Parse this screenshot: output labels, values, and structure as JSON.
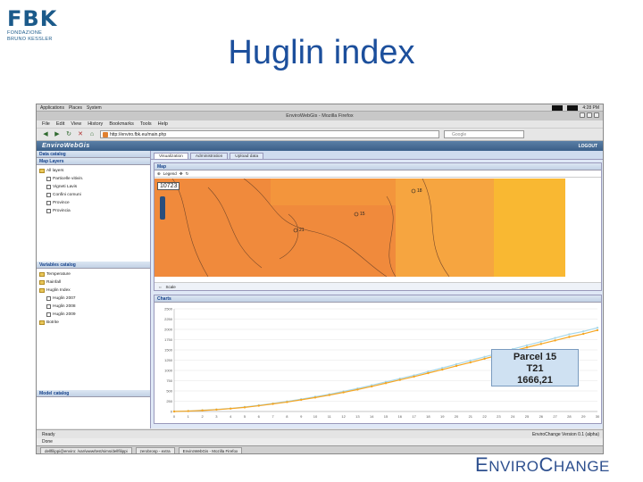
{
  "slide": {
    "title": "Huglin index"
  },
  "fbk_logo": {
    "mark": "FBK",
    "line1": "FONDAZIONE",
    "line2": "BRUNO KESSLER"
  },
  "footer_logo": {
    "text_big1": "E",
    "text_small1": "NVIRO",
    "text_big2": "C",
    "text_small2": "HANGE"
  },
  "desktop": {
    "menu": [
      "Applications",
      "Places",
      "System"
    ],
    "clock": "4:28 PM"
  },
  "browser": {
    "window_title": "EnviroWebGis - Mozilla Firefox",
    "menu": [
      "File",
      "Edit",
      "View",
      "History",
      "Bookmarks",
      "Tools",
      "Help"
    ],
    "url": "http://enviro.fbk.eu/main.php",
    "search_placeholder": "Google",
    "status_left": "Ready",
    "status_right": "EnviroChange Version 0.1 (alpha)",
    "status_done": "Done"
  },
  "app": {
    "logo": "EnviroWebGis",
    "logout": "LOGOUT",
    "left": {
      "data_catalog": "Data catalog",
      "map_layers": "Map Layers",
      "layers": [
        {
          "label": "All layers",
          "kind": "folder"
        },
        {
          "label": "Particelle vitivin.",
          "kind": "check"
        },
        {
          "label": "Vigneti Lavis",
          "kind": "check"
        },
        {
          "label": "Confini comuni",
          "kind": "check"
        },
        {
          "label": "Province",
          "kind": "check"
        },
        {
          "label": "Provincia",
          "kind": "check"
        }
      ],
      "variables_catalog": "Variables catalog",
      "variables": [
        {
          "label": "Temperature",
          "kind": "folder"
        },
        {
          "label": "Rainfall",
          "kind": "folder"
        },
        {
          "label": "Huglin Index",
          "kind": "folder"
        },
        {
          "label": "Huglin 2007",
          "kind": "check"
        },
        {
          "label": "Huglin 2008",
          "kind": "check"
        },
        {
          "label": "Huglin 2009",
          "kind": "check"
        },
        {
          "label": "Botrite",
          "kind": "folder"
        }
      ],
      "model_catalog": "Model catalog"
    },
    "tabs": [
      "Visualization",
      "Administration",
      "Upload data"
    ],
    "map": {
      "title": "Map",
      "legend": "Legend",
      "badge": "10723",
      "points": [
        "18",
        "15",
        "21"
      ],
      "scale": "Scale"
    },
    "charts": {
      "title": "Charts"
    }
  },
  "taskbar": {
    "items": [
      "dellfilippi@enviro: /var/www/test/sims/dellfilippi",
      "zerobrosp - extra",
      "EnviroWebGis - Mozilla Firefox"
    ]
  },
  "tooltip": {
    "line1": "Parcel 15",
    "line2": "T21",
    "line3": "1666,21"
  },
  "colors": {
    "title_blue": "#1c4f9c",
    "map_orange": "#f08a3c",
    "map_light_orange": "#f6a540",
    "map_yellow": "#f9b832",
    "series_cyan": "#a8d8ea",
    "series_orange": "#f5a623"
  },
  "chart_data": {
    "type": "line",
    "x": [
      0,
      1,
      2,
      3,
      4,
      5,
      6,
      7,
      8,
      9,
      10,
      11,
      12,
      13,
      14,
      15,
      16,
      17,
      18,
      19,
      20,
      21,
      22,
      23,
      24,
      25,
      26,
      27,
      28,
      29,
      30
    ],
    "yticks": [
      0,
      250,
      500,
      750,
      1000,
      1250,
      1500,
      1750,
      2000,
      2250,
      2500
    ],
    "ylim": [
      0,
      2500
    ],
    "xlim": [
      0,
      30
    ],
    "grid": true,
    "series": [
      {
        "color": "#a8d8ea",
        "values": [
          0,
          12,
          30,
          50,
          75,
          110,
          150,
          195,
          245,
          300,
          360,
          420,
          490,
          560,
          640,
          720,
          800,
          880,
          970,
          1060,
          1150,
          1240,
          1330,
          1420,
          1520,
          1610,
          1700,
          1790,
          1880,
          1950,
          2040
        ]
      },
      {
        "color": "#f5a623",
        "values": [
          0,
          10,
          25,
          45,
          70,
          100,
          140,
          185,
          230,
          285,
          340,
          400,
          465,
          535,
          610,
          690,
          770,
          850,
          935,
          1020,
          1110,
          1195,
          1285,
          1375,
          1470,
          1560,
          1645,
          1730,
          1815,
          1890,
          1980
        ]
      }
    ]
  }
}
